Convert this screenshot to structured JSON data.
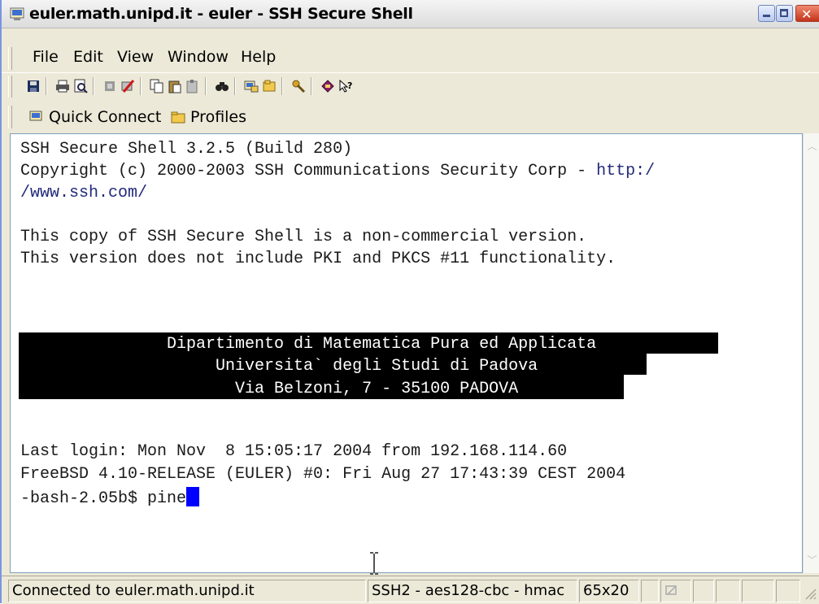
{
  "window": {
    "title": "euler.math.unipd.it - euler - SSH Secure Shell"
  },
  "menu": {
    "items": [
      {
        "label": "File"
      },
      {
        "label": "Edit"
      },
      {
        "label": "View"
      },
      {
        "label": "Window"
      },
      {
        "label": "Help"
      }
    ]
  },
  "toolbar": {
    "icons": [
      "save-icon",
      "print-icon",
      "print-preview-icon",
      "disconnect-icon",
      "settings-icon",
      "copy-icon",
      "paste-icon",
      "paste-plain-icon",
      "find-icon",
      "file-transfer-icon",
      "new-terminal-icon",
      "key-icon",
      "help-book-icon",
      "context-help-icon"
    ]
  },
  "quickbar": {
    "quick_connect": "Quick Connect",
    "profiles": "Profiles"
  },
  "terminal": {
    "line1": "SSH Secure Shell 3.2.5 (Build 280)",
    "line2a": "Copyright (c) 2000-2003 SSH Communications Security Corp - ",
    "line2b": "http:/",
    "line3": "/www.ssh.com/",
    "line4": "This copy of SSH Secure Shell is a non-commercial version.",
    "line5": "This version does not include PKI and PKCS #11 functionality.",
    "banner1": "               Dipartimento di Matematica Pura ed Applicata",
    "banner2": "                    Universita` degli Studi di Padova",
    "banner3": "                      Via Belzoni, 7 - 35100 PADOVA",
    "line6": "Last login: Mon Nov  8 15:05:17 2004 from 192.168.114.60",
    "line7": "FreeBSD 4.10-RELEASE (EULER) #0: Fri Aug 27 17:43:39 CEST 2004",
    "prompt": "-bash-2.05b$ pine"
  },
  "status": {
    "connection": "Connected to euler.math.unipd.it",
    "cipher": "SSH2 - aes128-cbc - hmac",
    "size": "65x20"
  },
  "colors": {
    "cursor": "#0000ff",
    "banner_bg": "#000000",
    "link": "#222a7a"
  }
}
